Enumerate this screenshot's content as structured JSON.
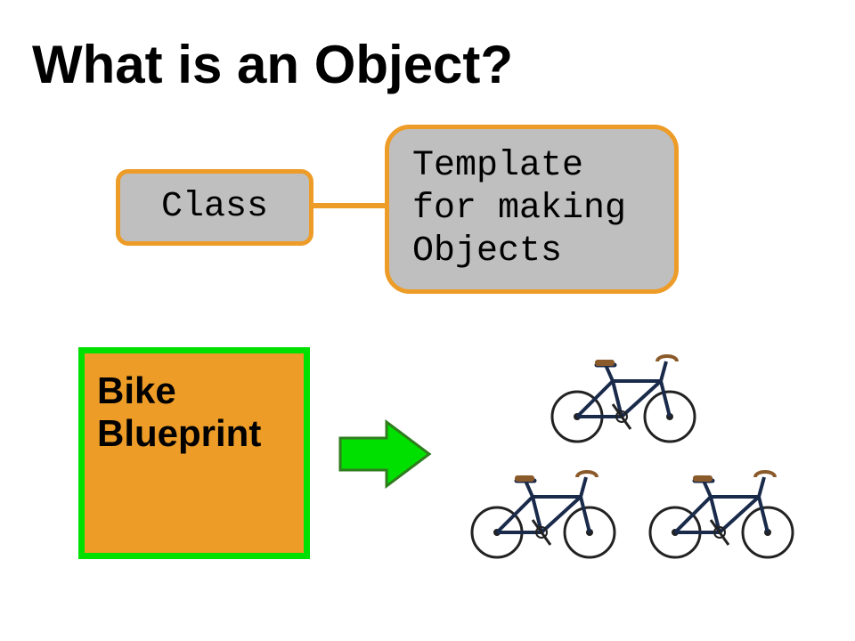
{
  "title": "What is an Object?",
  "class_box": "Class",
  "template_box": "Template for making Objects",
  "blueprint_box": "Bike Blueprint",
  "colors": {
    "box_border": "#ed9c28",
    "box_fill": "#bfbfbf",
    "blueprint_fill": "#ed9c28",
    "blueprint_border": "#00e000",
    "arrow_fill": "#00e000",
    "arrow_border": "#2f7d1f"
  },
  "icons": {
    "arrow": "right-arrow-icon",
    "bike": "bicycle-icon"
  },
  "bike_count": 3
}
